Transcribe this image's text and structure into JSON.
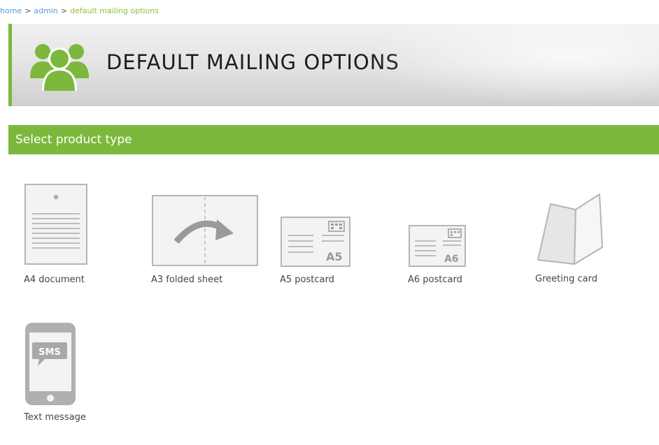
{
  "breadcrumb": {
    "items": [
      "home",
      "admin",
      "default mailing options"
    ],
    "separator": ">"
  },
  "header": {
    "title": "DEFAULT MAILING OPTIONS",
    "icon": "users-group-icon"
  },
  "section": {
    "title": "Select product type"
  },
  "products": [
    {
      "label": "A4 document",
      "icon": "a4-document-icon"
    },
    {
      "label": "A3 folded sheet",
      "icon": "a3-folded-sheet-icon"
    },
    {
      "label": "A5 postcard",
      "icon": "a5-postcard-icon",
      "size_text": "A5"
    },
    {
      "label": "A6 postcard",
      "icon": "a6-postcard-icon",
      "size_text": "A6"
    },
    {
      "label": "Greeting card",
      "icon": "greeting-card-icon"
    },
    {
      "label": "Text message",
      "icon": "sms-phone-icon",
      "badge_text": "SMS"
    }
  ],
  "colors": {
    "accent": "#7cb83b",
    "link": "#5b9bd5",
    "icon_gray": "#aaaaaa"
  }
}
